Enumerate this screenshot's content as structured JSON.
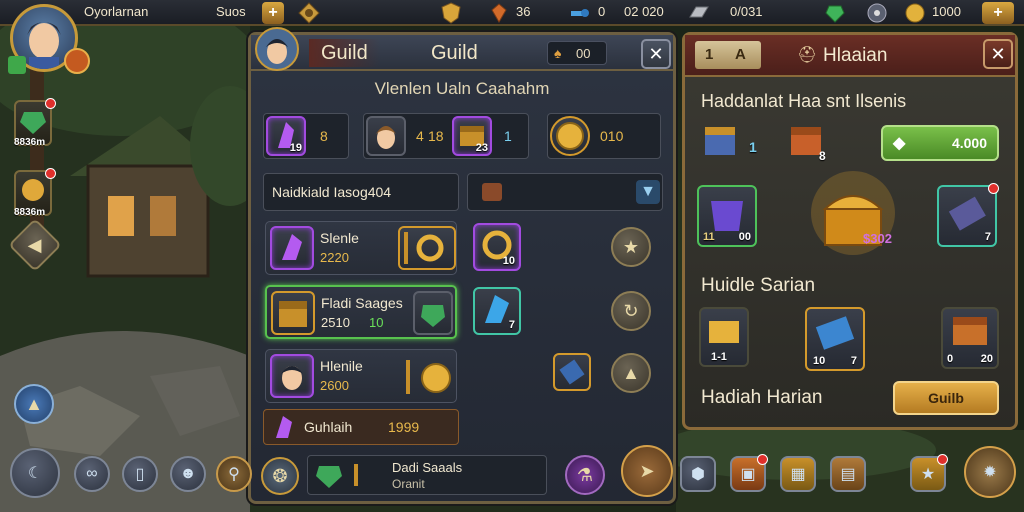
{
  "topbar": {
    "player_name": "Oyorlarnan",
    "server_label": "Suos",
    "gems": "36",
    "key_count": "0",
    "key_text": "02 020",
    "silver": "0/031",
    "gold": "1000"
  },
  "left": {
    "side_item_1_count": "8836m",
    "side_item_2_count": "8836m"
  },
  "guild": {
    "tab1": "Guild",
    "tab2": "Guild",
    "currency_count": "00",
    "subtitle": "Vlenlen Ualn Caahahm",
    "stat_gem": "8",
    "stat_gem_sub": "19",
    "stat_hero": "4",
    "stat_hero_accent": "18",
    "stat_hero_sub": "23",
    "stat_hero_val": "1",
    "stat_coin": "010",
    "search_value": "Naidkiald Iasog404",
    "items": [
      {
        "name": "Slenle",
        "value": "2220"
      },
      {
        "name": "Fladi Saages",
        "value": "2510",
        "value2": "10"
      },
      {
        "name": "Hlenile",
        "value": "2600"
      }
    ],
    "grid_counts": [
      "10",
      "7"
    ],
    "footer_label": "Guhlaih",
    "footer_value": "1999",
    "chat_line1": "Dadi Saaals",
    "chat_line2": "Oranit"
  },
  "reward": {
    "title": "Hlaaian",
    "tab_num": "1",
    "tab_letter": "A",
    "heading1": "Haddanlat Haa snt Ilsenis",
    "top_item1_count": "1",
    "top_item2_count": "8",
    "claim_value": "4.000",
    "row2_left_count": "00",
    "row2_left_accent": "11",
    "row2_right_count": "7",
    "chest_label": "$302",
    "heading2": "Huidle Sarian",
    "row3_counts": [
      "1-1",
      "10",
      "7",
      "0",
      "20"
    ],
    "heading3": "Hadiah Harian",
    "button_label": "Guilb"
  },
  "colors": {
    "gold": "#d49a2c",
    "purple": "#a24be0",
    "green": "#58c24e",
    "frame": "#6d5f41"
  }
}
